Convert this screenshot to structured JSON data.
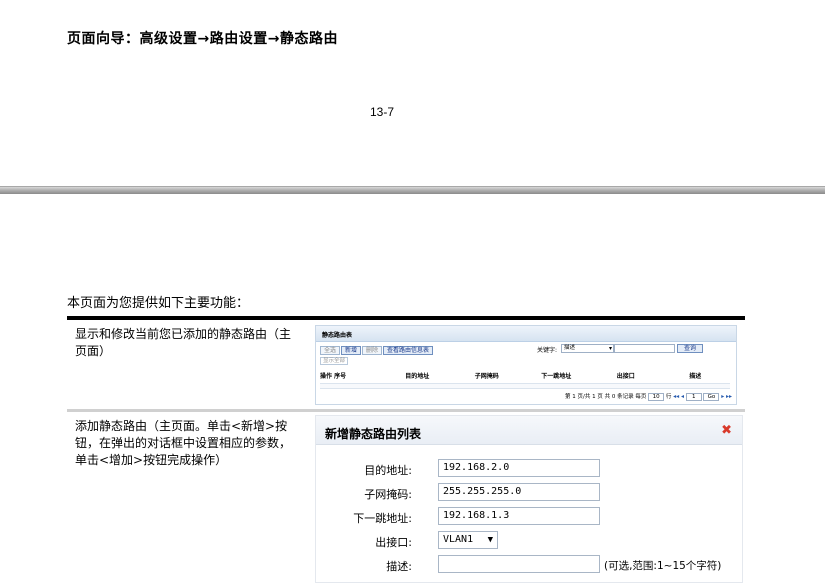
{
  "nav": {
    "title": "页面向导：高级设置→路由设置→静态路由"
  },
  "page_number": "13-7",
  "intro": "本页面为您提供如下主要功能：",
  "rows": [
    {
      "description": "显示和修改当前您已添加的静态路由（主页面）",
      "list_panel": {
        "title": "静态路由表",
        "buttons": [
          "全选",
          "新增",
          "删除",
          "查看路由信息表"
        ],
        "show_all": "显示全部",
        "keyword_label": "关键字:",
        "keyword_option": "描述",
        "query_button": "查询",
        "columns": [
          "操作 序号",
          "目的地址",
          "子网掩码",
          "下一跳地址",
          "出接口",
          "描述"
        ],
        "pager": {
          "summary": "第 1 页/共 1 页 共 0 条记录 每页",
          "per_page": "10",
          "row_text": "行",
          "page_value": "1",
          "go_label": "Go"
        }
      }
    },
    {
      "description": "添加静态路由（主页面。单击<新增>按钮，在弹出的对话框中设置相应的参数，单击<增加>按钮完成操作）",
      "dialog": {
        "title": "新增静态路由列表",
        "fields": [
          {
            "label": "目的地址:",
            "value": "192.168.2.0"
          },
          {
            "label": "子网掩码:",
            "value": "255.255.255.0"
          },
          {
            "label": "下一跳地址:",
            "value": "192.168.1.3"
          },
          {
            "label": "出接口:",
            "value": "VLAN1"
          },
          {
            "label": "描述:",
            "value": "",
            "hint": "(可选,范围:1~15个字符)"
          }
        ]
      }
    }
  ]
}
